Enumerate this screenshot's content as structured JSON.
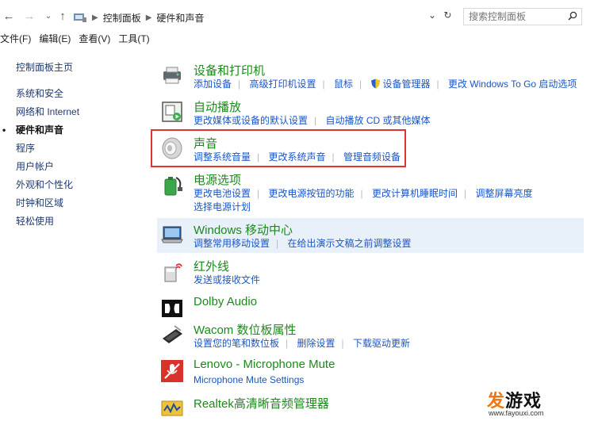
{
  "address_bar": {
    "breadcrumbs": [
      "控制面板",
      "硬件和声音"
    ],
    "search_placeholder": "搜索控制面板"
  },
  "menu": [
    "文件(F)",
    "编辑(E)",
    "查看(V)",
    "工具(T)"
  ],
  "sidebar": {
    "items": [
      {
        "label": "控制面板主页",
        "active": false
      },
      {
        "label": "系统和安全",
        "active": false
      },
      {
        "label": "网络和 Internet",
        "active": false
      },
      {
        "label": "硬件和声音",
        "active": true
      },
      {
        "label": "程序",
        "active": false
      },
      {
        "label": "用户帐户",
        "active": false
      },
      {
        "label": "外观和个性化",
        "active": false
      },
      {
        "label": "时钟和区域",
        "active": false
      },
      {
        "label": "轻松使用",
        "active": false
      }
    ]
  },
  "categories": [
    {
      "title": "设备和打印机",
      "icon": "printer-icon",
      "links": [
        "添加设备",
        "高级打印机设置",
        "鼠标",
        "设备管理器",
        "更改 Windows To Go 启动选项"
      ]
    },
    {
      "title": "自动播放",
      "icon": "autoplay-icon",
      "links": [
        "更改媒体或设备的默认设置",
        "自动播放 CD 或其他媒体"
      ]
    },
    {
      "title": "声音",
      "icon": "speaker-icon",
      "links": [
        "调整系统音量",
        "更改系统声音",
        "管理音频设备"
      ]
    },
    {
      "title": "电源选项",
      "icon": "power-icon",
      "links": [
        "更改电池设置",
        "更改电源按钮的功能",
        "更改计算机睡眠时间",
        "调整屏幕亮度"
      ],
      "links2": [
        "选择电源计划"
      ]
    },
    {
      "title": "Windows 移动中心",
      "icon": "mobility-center-icon",
      "links": [
        "调整常用移动设置",
        "在给出演示文稿之前调整设置"
      ]
    },
    {
      "title": "红外线",
      "icon": "infrared-icon",
      "links": [
        "发送或接收文件"
      ]
    },
    {
      "title": "Dolby Audio",
      "icon": "dolby-icon",
      "links": []
    },
    {
      "title": "Wacom 数位板属性",
      "icon": "wacom-tablet-icon",
      "links": [
        "设置您的笔和数位板",
        "删除设置",
        "下载驱动更新"
      ]
    },
    {
      "title": "Lenovo - Microphone Mute",
      "icon": "microphone-mute-icon",
      "links": [
        "Microphone Mute Settings"
      ]
    },
    {
      "title": "Realtek高清晰音频管理器",
      "icon": "realtek-audio-icon",
      "links": []
    }
  ],
  "watermark": {
    "brand_orange": "发",
    "brand_black": "游戏",
    "url": "www.fayouxi.com"
  },
  "colors": {
    "title_green": "#1b8a1b",
    "link_blue": "#1a56c7",
    "highlight_red": "#e23333"
  }
}
